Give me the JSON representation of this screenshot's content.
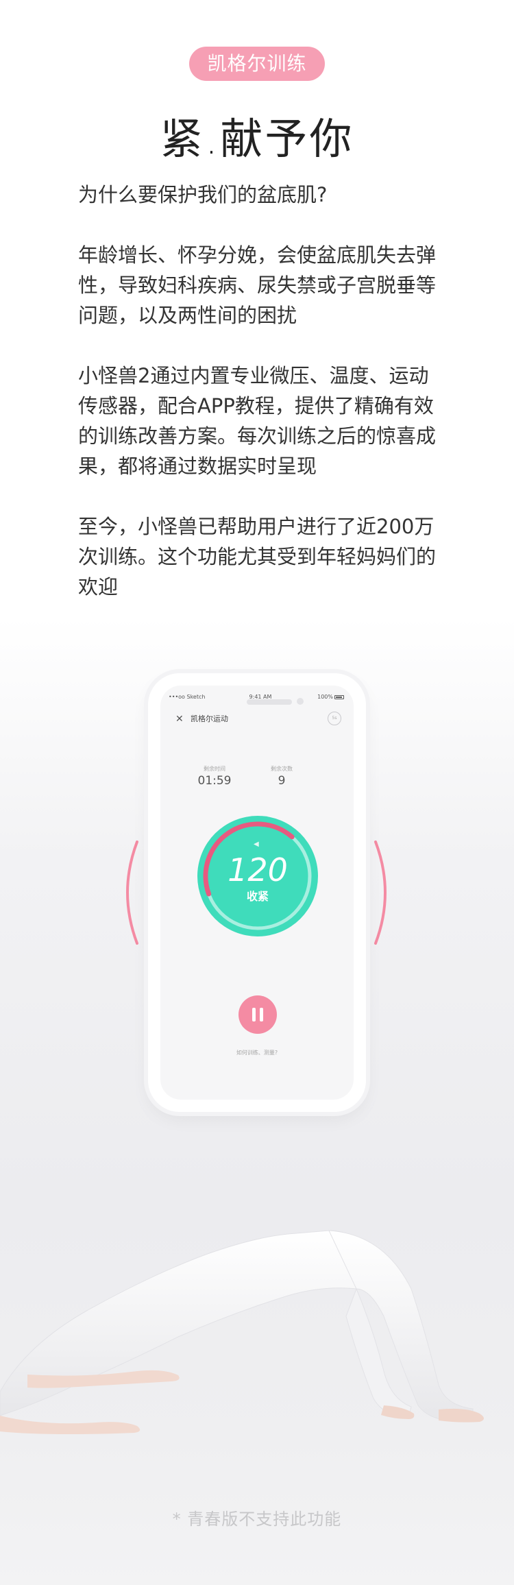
{
  "header": {
    "tag": "凯格尔训练",
    "title": "紧.献予你"
  },
  "content": {
    "question": "为什么要保护我们的盆底肌?",
    "paragraphs": [
      "年龄增长、怀孕分娩，会使盆底肌失去弹性，导致妇科疾病、尿失禁或子宫脱垂等问题，以及两性间的困扰",
      "小怪兽2通过内置专业微压、温度、运动传感器，配合APP教程，提供了精确有效的训练改善方案。每次训练之后的惊喜成果，都将通过数据实时呈现",
      "至今，小怪兽已帮助用户进行了近200万次训练。这个功能尤其受到年轻妈妈们的欢迎"
    ]
  },
  "phone": {
    "status_bar": {
      "carrier": "•••oo Sketch",
      "time": "9:41 AM",
      "battery": "100%"
    },
    "app_title": "凯格尔运动",
    "close_glyph": "✕",
    "timer_text": "5s",
    "stats": {
      "remaining_time_label": "剩余时间",
      "remaining_time_value": "01:59",
      "remaining_count_label": "剩余次数",
      "remaining_count_value": "9"
    },
    "gauge": {
      "value": "120",
      "label": "收紧",
      "progress_fraction": 0.42
    },
    "help_link": "如何训练、测量?"
  },
  "footnote": "* 青春版不支持此功能",
  "colors": {
    "accent_pink": "#f69fb4",
    "gauge_green": "#3fdcbb",
    "gauge_arc": "#e85a80"
  }
}
